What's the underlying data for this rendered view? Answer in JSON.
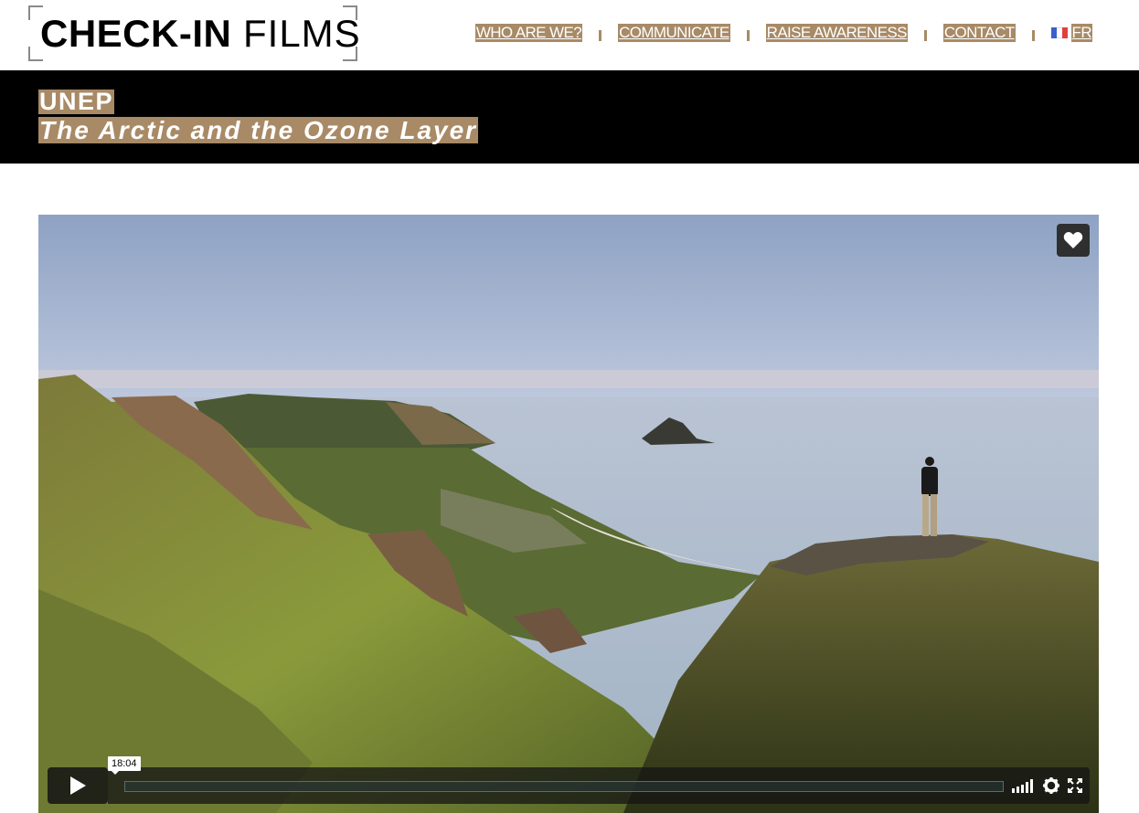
{
  "brand": {
    "bold": "CHECK-IN",
    "light": " FILMS"
  },
  "nav": {
    "items": [
      "WHO ARE WE?",
      "COMMUNICATE",
      "RAISE AWARENESS",
      "CONTACT"
    ],
    "lang": "FR",
    "flag_colors": [
      "#3a5fcd",
      "#ffffff",
      "#e04040"
    ]
  },
  "title_band": {
    "organization": "UNEP",
    "film_title": "The Arctic and the Ozone Layer"
  },
  "video": {
    "duration": "18:04",
    "progress_fraction": 0.0,
    "icons": [
      "heart-icon",
      "play-icon",
      "volume-icon",
      "gear-icon",
      "fullscreen-icon"
    ]
  },
  "colors": {
    "accent": "#a88a66",
    "band_bg": "#000000"
  }
}
